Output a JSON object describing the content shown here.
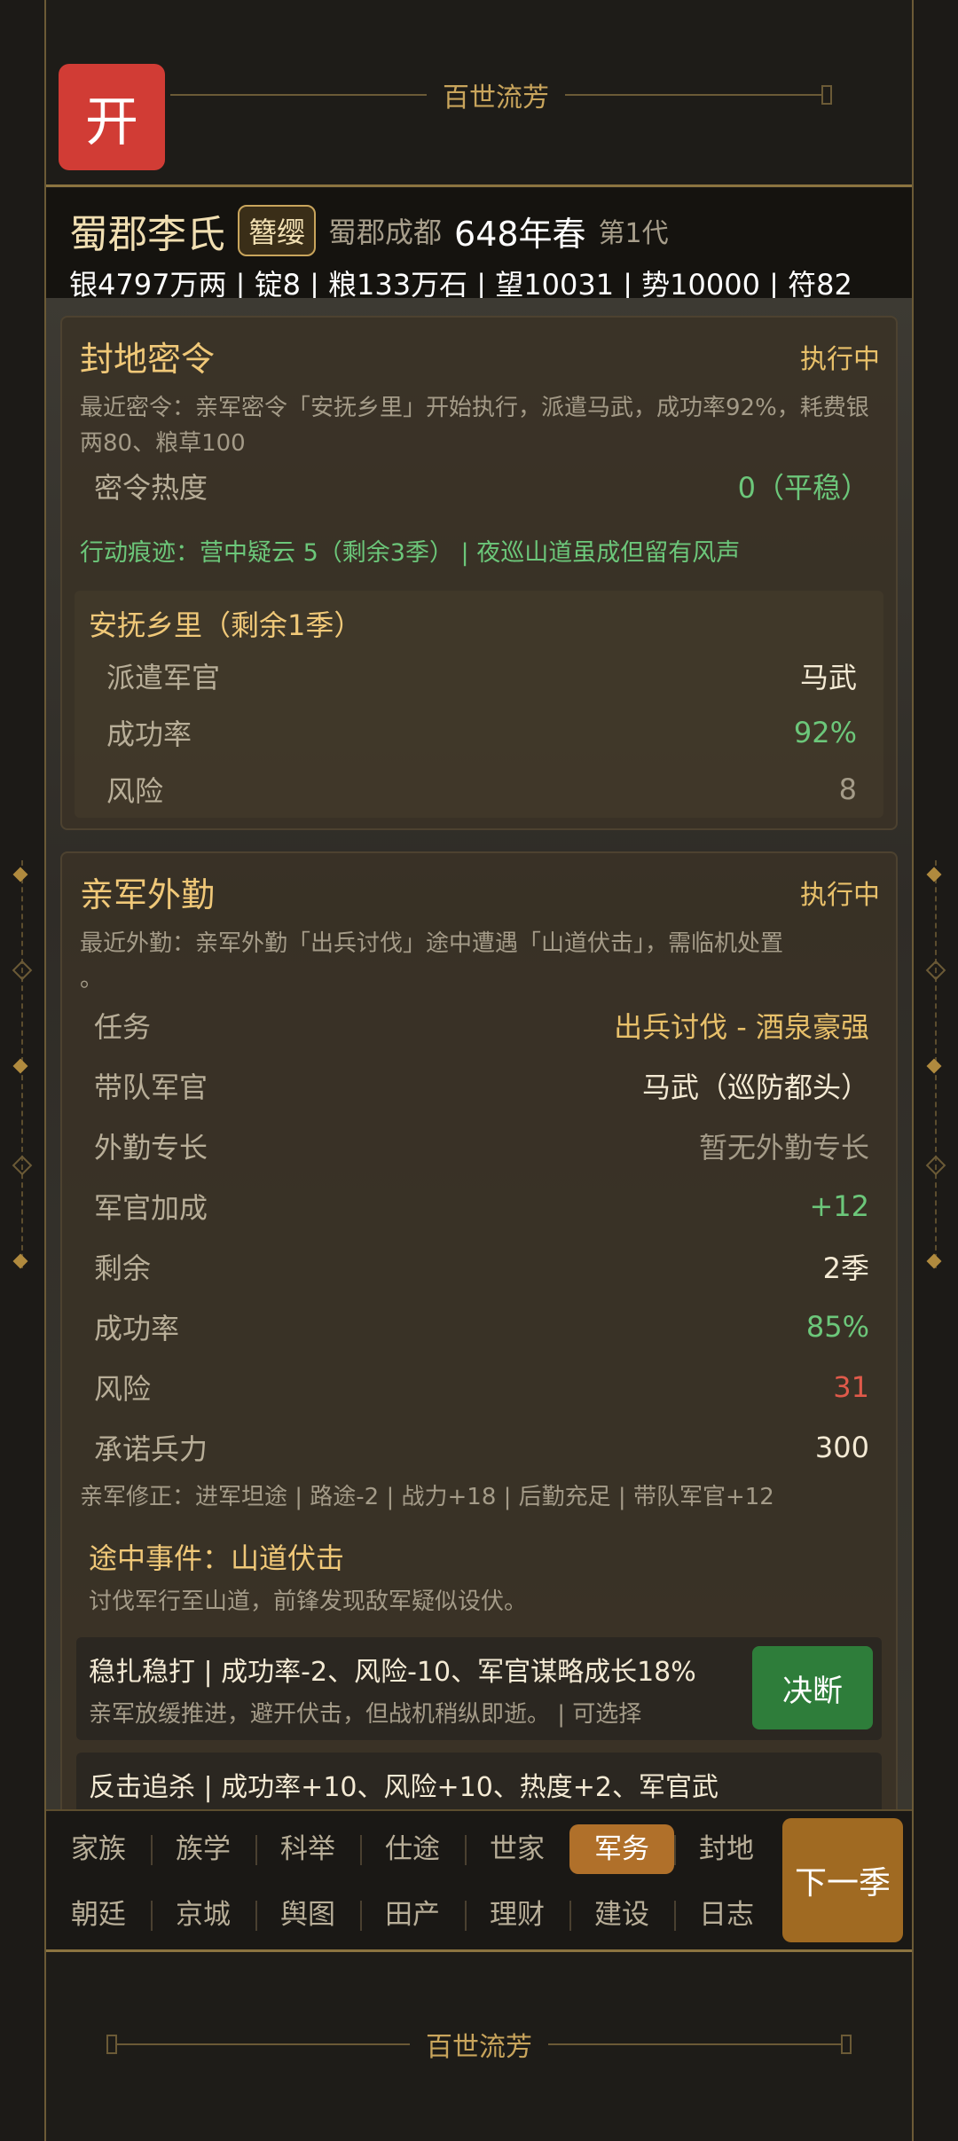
{
  "header": {
    "open_label": "开",
    "title": "百世流芳"
  },
  "status": {
    "clan": "蜀郡李氏",
    "badge": "簪缨",
    "location": "蜀郡成都",
    "year": "648年春",
    "generation": "第1代",
    "resources": "银4797万两 | 锭8 | 粮133万石 | 望10031 | 势10000 | 符82"
  },
  "secret_order": {
    "title": "封地密令",
    "state": "执行中",
    "recent": "最近密令：亲军密令「安抚乡里」开始执行，派遣马武，成功率92%，耗费银两80、粮草100",
    "heat_label": "密令热度",
    "heat_value": "0（平稳）",
    "traces": "行动痕迹：营中疑云 5（剩余3季） | 夜巡山道虽成但留有风声",
    "task": {
      "title": "安抚乡里（剩余1季）",
      "rows": [
        {
          "k": "派遣军官",
          "v": "马武"
        },
        {
          "k": "成功率",
          "v": "92%"
        },
        {
          "k": "风险",
          "v": "8"
        }
      ]
    }
  },
  "expedition": {
    "title": "亲军外勤",
    "state": "执行中",
    "recent_line1": "最近外勤：亲军外勤「出兵讨伐」途中遭遇「山道伏击」，需临机处置",
    "recent_line2": "。",
    "rows": [
      {
        "k": "任务",
        "v": "出兵讨伐 - 酒泉豪强"
      },
      {
        "k": "带队军官",
        "v": "马武（巡防都头）"
      },
      {
        "k": "外勤专长",
        "v": "暂无外勤专长"
      },
      {
        "k": "军官加成",
        "v": "+12"
      },
      {
        "k": "剩余",
        "v": "2季"
      },
      {
        "k": "成功率",
        "v": "85%"
      },
      {
        "k": "风险",
        "v": "31"
      },
      {
        "k": "承诺兵力",
        "v": "300"
      }
    ],
    "modifiers": "亲军修正：进军坦途 | 路途-2 | 战力+18 | 后勤充足 | 带队军官+12",
    "event_title": "途中事件：山道伏击",
    "event_desc": "讨伐军行至山道，前锋发现敌军疑似设伏。",
    "choices": [
      {
        "title": "稳扎稳打  |  成功率-2、风险-10、军官谋略成长18%",
        "desc": "亲军放缓推进，避开伏击，但战机稍纵即逝。  |  可选择",
        "button": "决断"
      },
      {
        "title": "反击追杀  |  成功率+10、风险+10、热度+2、军官武",
        "desc": "",
        "button": ""
      }
    ]
  },
  "nav": {
    "row1": [
      "家族",
      "族学",
      "科举",
      "仕途",
      "世家",
      "军务",
      "封地"
    ],
    "row2": [
      "朝廷",
      "京城",
      "舆图",
      "田产",
      "理财",
      "建设",
      "日志"
    ],
    "active": "军务",
    "next_label": "下一季"
  },
  "footer": {
    "title": "百世流芳"
  },
  "colors": {
    "accent_gold": "#c9a55c",
    "open_red": "#d13c35",
    "decide_green": "#2e7d3a",
    "active_tab": "#b0702a",
    "positive": "#6cc77a",
    "negative": "#e05a4a"
  }
}
